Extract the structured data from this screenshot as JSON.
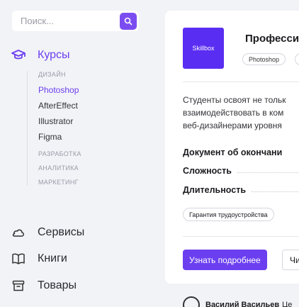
{
  "search": {
    "placeholder": "Поиск..."
  },
  "nav": {
    "courses": "Курсы",
    "services": "Сервисы",
    "books": "Книги",
    "goods": "Товары"
  },
  "submenu": {
    "design_label": "ДИЗАЙН",
    "design_items": [
      "Photoshop",
      "AfterEffect",
      "Illustrator",
      "Figma"
    ],
    "dev_label": "РАЗРАБОТКА",
    "analytics_label": "АНАЛИТИКА",
    "marketing_label": "МАРКЕТИНГ",
    "active_item": "Photoshop"
  },
  "card": {
    "logo_text": "Skillbox",
    "title": "Професси",
    "tags": [
      "Photoshop",
      ""
    ],
    "description": [
      "Студенты освоят не тольк",
      "взаимодействовать в ком",
      "веб-дизайнерами уровня"
    ],
    "specs": [
      "Документ об окончани",
      "Сложность",
      "Длительность"
    ],
    "badge": "Гарантия трудоустройства",
    "primary_button": "Узнать подробнее",
    "secondary_button": "Чи"
  },
  "author": {
    "name": "Василий Васильев",
    "extra": "Це"
  },
  "colors": {
    "accent": "#6b3ff0",
    "logo": "#5a2df2"
  }
}
